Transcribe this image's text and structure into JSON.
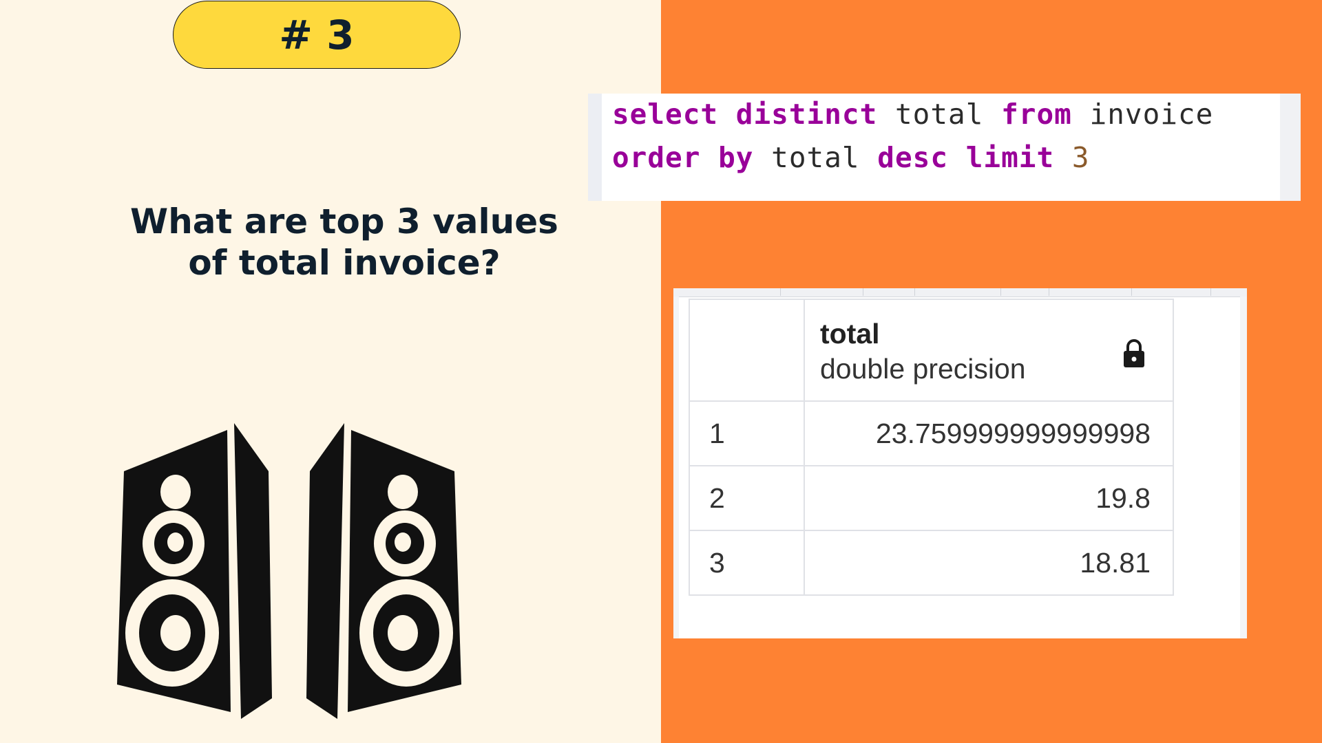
{
  "badge": {
    "label": "# 3"
  },
  "question": {
    "line1": "What are top 3 values",
    "line2": "of total invoice?"
  },
  "illustration": {
    "icon": "speakers-icon"
  },
  "sql": {
    "line1": [
      {
        "t": "select",
        "k": "kw"
      },
      {
        "t": " ",
        "k": "id"
      },
      {
        "t": "distinct",
        "k": "kw"
      },
      {
        "t": " total ",
        "k": "id"
      },
      {
        "t": "from",
        "k": "kw"
      },
      {
        "t": " invoice",
        "k": "id"
      }
    ],
    "line2": [
      {
        "t": "order by",
        "k": "kw"
      },
      {
        "t": " total ",
        "k": "id"
      },
      {
        "t": "desc",
        "k": "kw"
      },
      {
        "t": " ",
        "k": "id"
      },
      {
        "t": "limit",
        "k": "kw"
      },
      {
        "t": " ",
        "k": "id"
      },
      {
        "t": "3",
        "k": "num"
      }
    ]
  },
  "result": {
    "column": {
      "name": "total",
      "type": "double precision",
      "icon": "lock-icon"
    },
    "rows": [
      {
        "n": "1",
        "total": "23.759999999999998"
      },
      {
        "n": "2",
        "total": "19.8"
      },
      {
        "n": "3",
        "total": "18.81"
      }
    ]
  },
  "colors": {
    "left_bg": "#fef6e6",
    "right_bg": "#fe8233",
    "badge_bg": "#fed93d",
    "keyword": "#990099",
    "text_dark": "#0f1f2e"
  }
}
